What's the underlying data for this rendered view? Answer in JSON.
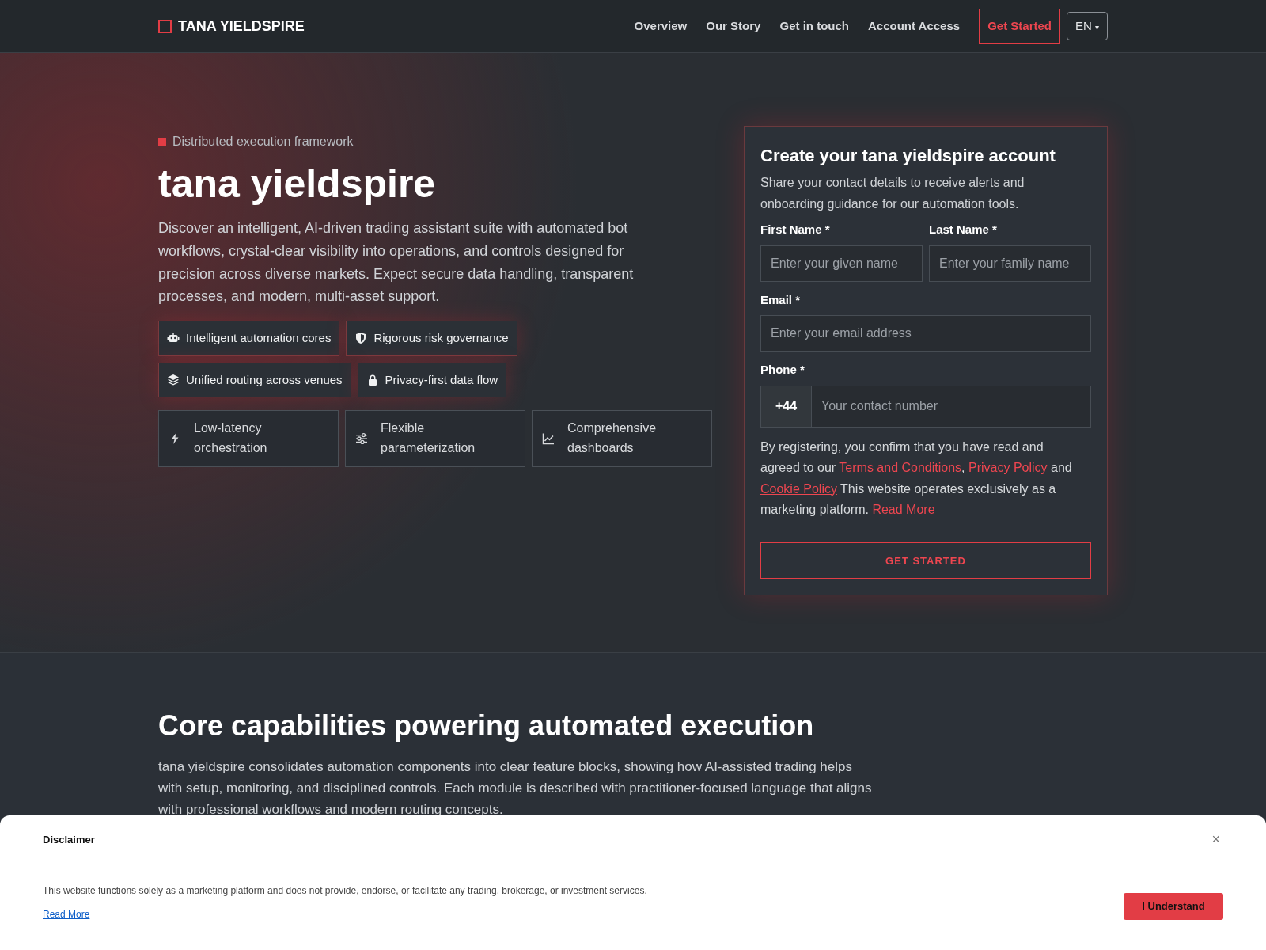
{
  "brand": {
    "name": "TANA YIELDSPIRE"
  },
  "nav": {
    "links": [
      "Overview",
      "Our Story",
      "Get in touch",
      "Account Access"
    ],
    "cta": "Get Started",
    "language": "EN",
    "language_caret": "▾"
  },
  "hero": {
    "eyebrow": "Distributed execution framework",
    "title": "tana yieldspire",
    "description": "Discover an intelligent, AI-driven trading assistant suite with automated bot workflows, crystal-clear visibility into operations, and controls designed for precision across diverse markets. Expect secure data handling, transparent processes, and modern, multi-asset support.",
    "tags": [
      {
        "kind": "robot",
        "label": "Intelligent automation cores"
      },
      {
        "kind": "shield",
        "label": "Rigorous risk governance"
      },
      {
        "kind": "layers",
        "label": "Unified routing across venues"
      },
      {
        "kind": "lock",
        "label": "Privacy-first data flow"
      }
    ],
    "features": [
      {
        "kind": "bolt",
        "label": "Low-latency orchestration"
      },
      {
        "kind": "sliders",
        "label": "Flexible parameterization"
      },
      {
        "kind": "chart",
        "label": "Comprehensive dashboards"
      }
    ]
  },
  "form": {
    "title": "Create your tana yieldspire account",
    "subtitle": "Share your contact details to receive alerts and onboarding guidance for our automation tools.",
    "first_name": {
      "label": "First Name *",
      "placeholder": "Enter your given name"
    },
    "last_name": {
      "label": "Last Name *",
      "placeholder": "Enter your family name"
    },
    "email": {
      "label": "Email *",
      "placeholder": "Enter your email address"
    },
    "phone": {
      "label": "Phone *",
      "prefix": "+44",
      "placeholder": "Your contact number"
    },
    "consent": [
      {
        "text": "By registering, you confirm that you have read and agreed to our ",
        "link": false
      },
      {
        "text": "Terms and Conditions",
        "link": true
      },
      {
        "text": ", ",
        "link": false
      },
      {
        "text": "Privacy Policy",
        "link": true
      },
      {
        "text": " and ",
        "link": false
      },
      {
        "text": "Cookie Policy",
        "link": true
      },
      {
        "text": " This website operates exclusively as a marketing platform. ",
        "link": false
      },
      {
        "text": "Read More",
        "link": true
      }
    ],
    "submit": "GET STARTED"
  },
  "capabilities": {
    "title": "Core capabilities powering automated execution",
    "description": "tana yieldspire consolidates automation components into clear feature blocks, showing how AI-assisted trading helps with setup, monitoring, and disciplined controls. Each module is described with practitioner-focused language that aligns with professional workflows and modern routing concepts."
  },
  "disclaimer": {
    "title": "Disclaimer",
    "close": "×",
    "text": "This website functions solely as a marketing platform and does not provide, endorse, or facilitate any trading, brokerage, or investment services.",
    "link": "Read More",
    "button": "I Understand"
  }
}
